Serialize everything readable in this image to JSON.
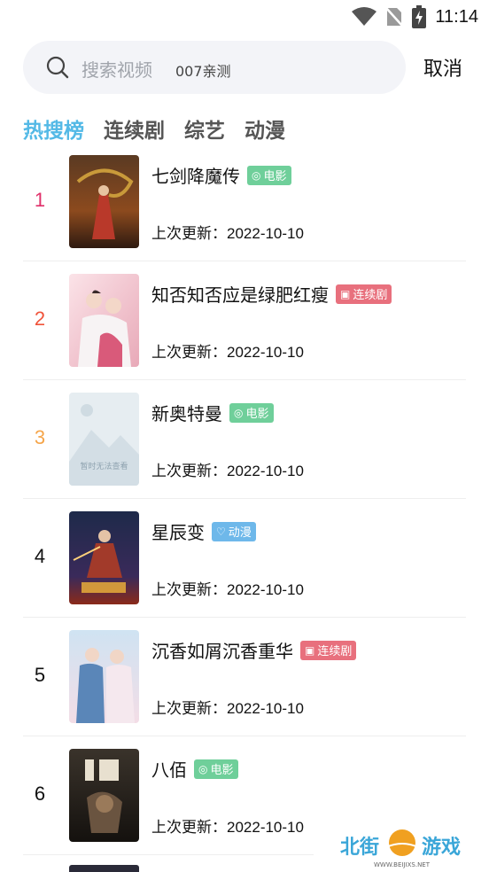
{
  "status_bar": {
    "time": "11:14",
    "icons": [
      "wifi-icon",
      "no-sim-icon",
      "battery-charging-icon"
    ]
  },
  "search": {
    "placeholder": "搜索视频",
    "hint": "007亲测",
    "cancel_label": "取消"
  },
  "tabs": [
    {
      "label": "热搜榜",
      "active": true
    },
    {
      "label": "连续剧",
      "active": false
    },
    {
      "label": "综艺",
      "active": false
    },
    {
      "label": "动漫",
      "active": false
    }
  ],
  "results": [
    {
      "rank": "1",
      "rank_color": "#e0306a",
      "title": "七剑降魔传",
      "badge": "电影",
      "badge_color": "#6fcf9a",
      "update_label": "上次更新：",
      "update_date": "2022-10-10"
    },
    {
      "rank": "2",
      "rank_color": "#f0533a",
      "title": "知否知否应是绿肥红瘦",
      "badge": "连续剧",
      "badge_color": "#e8707d",
      "update_label": "上次更新：",
      "update_date": "2022-10-10"
    },
    {
      "rank": "3",
      "rank_color": "#f5a54a",
      "title": "新奥特曼",
      "badge": "电影",
      "badge_color": "#6fcf9a",
      "update_label": "上次更新：",
      "update_date": "2022-10-10"
    },
    {
      "rank": "4",
      "rank_color": "#111111",
      "title": "星辰变",
      "badge": "动漫",
      "badge_color": "#6eb8ea",
      "update_label": "上次更新：",
      "update_date": "2022-10-10"
    },
    {
      "rank": "5",
      "rank_color": "#111111",
      "title": "沉香如屑沉香重华",
      "badge": "连续剧",
      "badge_color": "#e8707d",
      "update_label": "上次更新：",
      "update_date": "2022-10-10"
    },
    {
      "rank": "6",
      "rank_color": "#111111",
      "title": "八佰",
      "badge": "电影",
      "badge_color": "#6fcf9a",
      "update_label": "上次更新：",
      "update_date": "2022-10-10"
    }
  ],
  "poster_placeholder_text": "暂时无法查看",
  "watermark": {
    "brand_left": "北街",
    "brand_right": "游戏",
    "url": "WWW.BEIJIXS.NET"
  }
}
